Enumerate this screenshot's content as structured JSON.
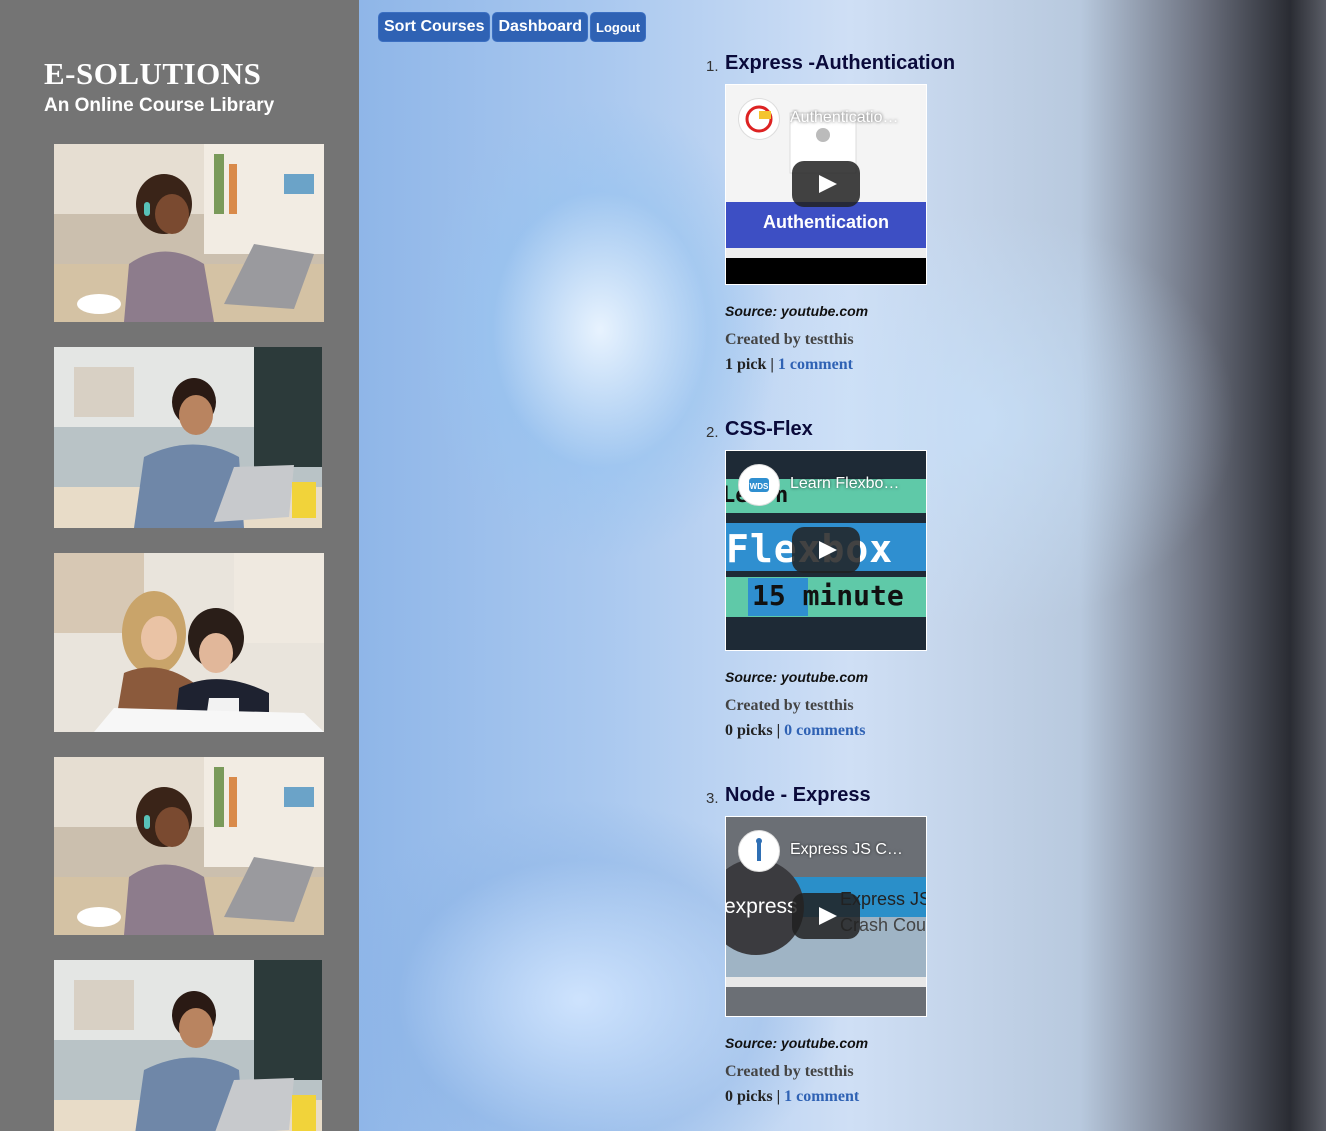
{
  "brand": {
    "title": "E-SOLUTIONS",
    "subtitle": "An Online Course Library"
  },
  "nav": {
    "sort_courses": "Sort Courses",
    "dashboard": "Dashboard",
    "logout": "Logout"
  },
  "sidebar_images": [
    {
      "name": "student-girl-laptop-image"
    },
    {
      "name": "student-boy-laptop-image"
    },
    {
      "name": "two-women-computer-image"
    },
    {
      "name": "student-girl-laptop-image"
    },
    {
      "name": "student-boy-laptop-image"
    }
  ],
  "courses": [
    {
      "number": "1.",
      "title": "Express -Authentication",
      "video_title": "Authenticatio…",
      "video_caption": "Authentication",
      "source": "Source: youtube.com",
      "created_by": "Created by testthis",
      "picks": "1 pick",
      "separator": " | ",
      "comments": "1 comment"
    },
    {
      "number": "2.",
      "title": "CSS-Flex",
      "video_title": "Learn Flexbo…",
      "video_lines": [
        "Learn",
        "Flexbox",
        "15 minute"
      ],
      "source": "Source: youtube.com",
      "created_by": "Created by testthis",
      "picks": "0 picks",
      "separator": " | ",
      "comments": "0 comments"
    },
    {
      "number": "3.",
      "title": "Node - Express",
      "video_title": "Express JS C…",
      "video_lines": [
        "express",
        "Express JS",
        "Crash Cours"
      ],
      "source": "Source: youtube.com",
      "created_by": "Created by testthis",
      "picks": "0 picks",
      "separator": " | ",
      "comments": "1 comment"
    }
  ],
  "colors": {
    "sidebar": "#747474",
    "button": "#2f62b4",
    "link": "#2f62b4"
  }
}
